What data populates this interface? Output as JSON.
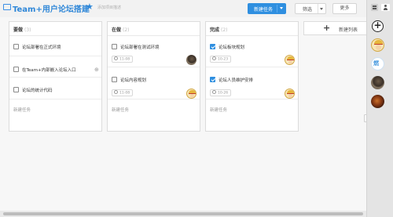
{
  "header": {
    "project_icon": "folder-icon",
    "title": "Team+用户论坛搭建",
    "star_glyph": "★",
    "subtitle": "添加项目描述",
    "new_task_button": "新建任务",
    "filter_button": "筛选",
    "more_button": "更多"
  },
  "columns": [
    {
      "title": "要做",
      "count": "(3)",
      "cards": [
        {
          "title": "论坛部署在正式环境",
          "checked": false
        },
        {
          "title": "在Team+内部嵌入论坛入口",
          "checked": false,
          "action_icon": "⊕"
        },
        {
          "title": "论坛的统计代码",
          "checked": false
        }
      ],
      "new_task": "新建任务"
    },
    {
      "title": "在做",
      "count": "(2)",
      "cards": [
        {
          "title": "论坛部署在测试环境",
          "checked": false,
          "date": "11-08",
          "assignee": "dark-photo"
        },
        {
          "title": "论坛内容规划",
          "checked": false,
          "date": "11-08",
          "assignee": "luffy-cartoon"
        }
      ],
      "new_task": "新建任务"
    },
    {
      "title": "完成",
      "count": "(2)",
      "cards": [
        {
          "title": "论坛板块规划",
          "checked": true,
          "date": "10-23",
          "assignee": "luffy-cartoon"
        },
        {
          "title": "论坛人员维护安排",
          "checked": true,
          "date": "10-26",
          "assignee": "luffy-cartoon"
        }
      ],
      "new_task": "新建任务"
    }
  ],
  "new_list": {
    "label": "新建列表",
    "plus": "+"
  },
  "right_rail": {
    "add_glyph": "+",
    "brand_avatar_text": "燃"
  },
  "colors": {
    "accent": "#2f8fe0",
    "title_blue": "#2f87d8"
  }
}
